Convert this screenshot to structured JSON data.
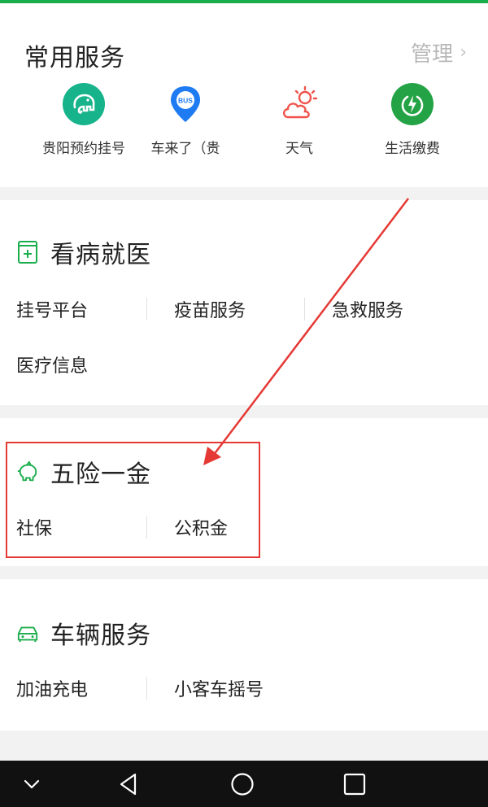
{
  "common": {
    "title": "常用服务",
    "manage_label": "管理",
    "services": [
      {
        "label": "贵阳预约挂号",
        "icon": "elephant-icon",
        "color": "#17b38a"
      },
      {
        "label": "车来了（贵",
        "icon": "bus-pin-icon",
        "color": "#1e7bf2"
      },
      {
        "label": "天气",
        "icon": "weather-sun-cloud-icon",
        "color": "#f0534a"
      },
      {
        "label": "生活缴费",
        "icon": "power-bolt-icon",
        "color": "#23a345"
      }
    ]
  },
  "categories": [
    {
      "title": "看病就医",
      "icon": "medical-kit-icon",
      "items": [
        "挂号平台",
        "疫苗服务",
        "急救服务",
        "医疗信息"
      ]
    },
    {
      "title": "五险一金",
      "icon": "piggy-bank-icon",
      "items": [
        "社保",
        "公积金"
      ]
    },
    {
      "title": "车辆服务",
      "icon": "car-icon",
      "items": [
        "加油充电",
        "小客车摇号"
      ]
    }
  ],
  "colors": {
    "accent": "#1aad4b",
    "annotation": "#e53935",
    "navbar": "#111111"
  }
}
